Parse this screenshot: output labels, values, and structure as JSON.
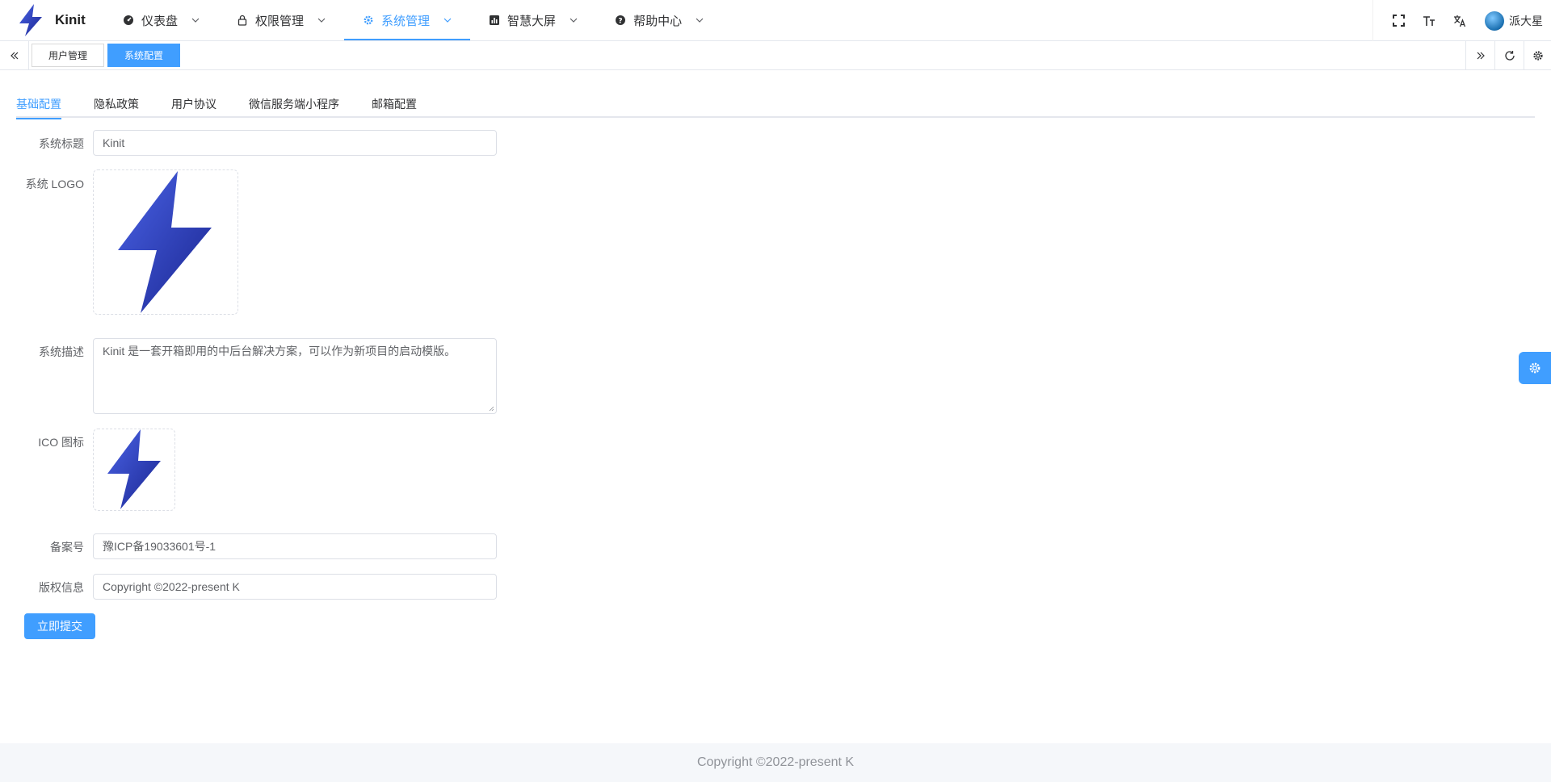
{
  "app": {
    "name": "Kinit",
    "brand_color": "#409eff",
    "logo_gradient": [
      "#3a52d8",
      "#1c2a9c"
    ]
  },
  "menu": [
    {
      "label": "仪表盘",
      "icon": "dashboard-icon"
    },
    {
      "label": "权限管理",
      "icon": "lock-icon"
    },
    {
      "label": "系统管理",
      "icon": "gear-icon",
      "active": true
    },
    {
      "label": "智慧大屏",
      "icon": "bar-chart-icon"
    },
    {
      "label": "帮助中心",
      "icon": "help-icon"
    }
  ],
  "header_right": {
    "icons": [
      "fullscreen-icon",
      "font-size-icon",
      "translate-icon"
    ],
    "user_name": "派大星"
  },
  "tags": [
    {
      "label": "用户管理"
    },
    {
      "label": "系统配置",
      "active": true
    }
  ],
  "tabs": [
    {
      "label": "基础配置",
      "active": true
    },
    {
      "label": "隐私政策"
    },
    {
      "label": "用户协议"
    },
    {
      "label": "微信服务端小程序"
    },
    {
      "label": "邮箱配置"
    }
  ],
  "form": {
    "title_label": "系统标题",
    "title_value": "Kinit",
    "logo_label": "系统 LOGO",
    "desc_label": "系统描述",
    "desc_value": "Kinit 是一套开箱即用的中后台解决方案，可以作为新项目的启动模版。",
    "ico_label": "ICO 图标",
    "icp_label": "备案号",
    "icp_value": "豫ICP备19033601号-1",
    "copyright_label": "版权信息",
    "copyright_value": "Copyright ©2022-present K",
    "submit_label": "立即提交"
  },
  "footer": {
    "text": "Copyright ©2022-present K"
  }
}
